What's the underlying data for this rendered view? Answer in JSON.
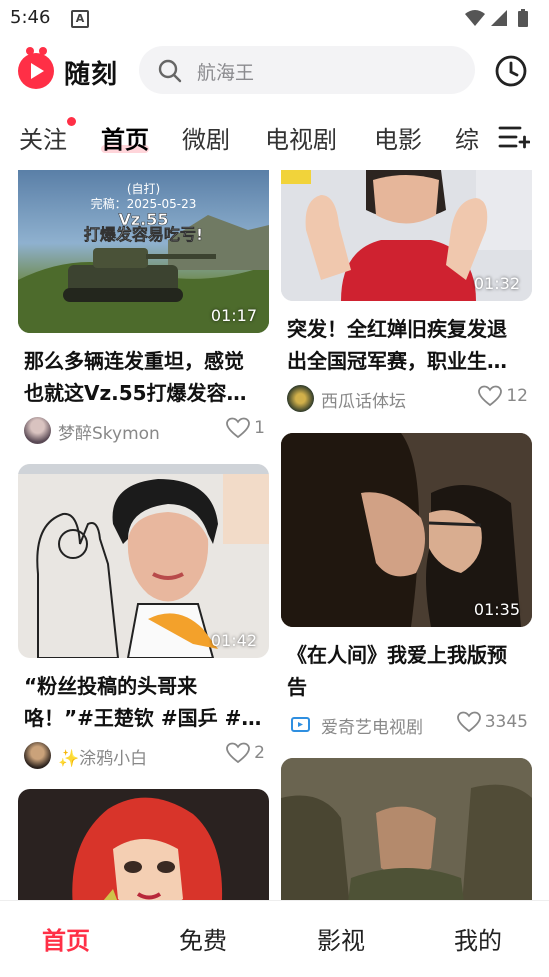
{
  "status_bar": {
    "time": "5:46",
    "notification_icon": "A"
  },
  "header": {
    "brand": "随刻",
    "search_placeholder": "航海王"
  },
  "tabs": [
    {
      "label": "关注",
      "has_dot": true
    },
    {
      "label": "首页",
      "active": true
    },
    {
      "label": "微剧"
    },
    {
      "label": "电视剧"
    },
    {
      "label": "电影"
    },
    {
      "label": "综"
    }
  ],
  "feed": {
    "left": [
      {
        "overlay_lines": [
          "(自打)",
          "完稿：2025-05-23",
          "Vz.55",
          "打爆发容易吃亏!"
        ],
        "duration": "01:17",
        "title": "那么多辆连发重坦，感觉也就这Vz.55打爆发容…",
        "author": "梦醉Skymon",
        "likes": "1"
      },
      {
        "duration": "01:42",
        "title": "“粉丝投稿的头哥来咯！”#王楚钦 #国乒 #…",
        "author": "涂鸦小白",
        "likes": "2"
      },
      {}
    ],
    "right": [
      {
        "duration": "01:32",
        "title": "突发！全红婵旧疾复发退出全国冠军赛，职业生…",
        "author": "西瓜话体坛",
        "likes": "12"
      },
      {
        "duration": "01:35",
        "title": "《在人间》我爱上我版预告",
        "author": "爱奇艺电视剧",
        "likes": "3345"
      },
      {}
    ]
  },
  "bottom_nav": [
    {
      "label": "首页",
      "active": true
    },
    {
      "label": "免费"
    },
    {
      "label": "影视"
    },
    {
      "label": "我的"
    }
  ],
  "colors": {
    "accent": "#ff2f46",
    "search_bg": "#f3f3f5",
    "text_secondary": "#888888"
  }
}
